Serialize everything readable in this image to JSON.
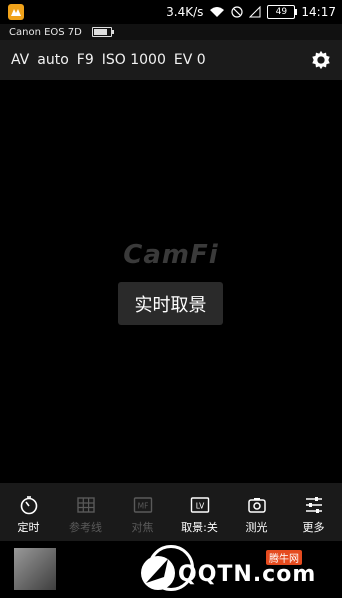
{
  "status": {
    "speed": "3.4K/s",
    "battery": "49",
    "time": "14:17"
  },
  "camera": {
    "name": "Canon EOS 7D",
    "battery_level": 0.85
  },
  "params": [
    "AV",
    "auto",
    "F9",
    "ISO 1000",
    "EV 0"
  ],
  "logo": "CamFi",
  "live_view_label": "实时取景",
  "toolbar": [
    {
      "label": "定时",
      "icon": "timer-icon",
      "enabled": true
    },
    {
      "label": "参考线",
      "icon": "grid-icon",
      "enabled": false
    },
    {
      "label": "对焦",
      "icon": "mf-icon",
      "icon_text": "MF",
      "enabled": false
    },
    {
      "label": "取景:关",
      "icon": "lv-icon",
      "icon_text": "LV",
      "enabled": true
    },
    {
      "label": "测光",
      "icon": "metering-icon",
      "enabled": true
    },
    {
      "label": "更多",
      "icon": "sliders-icon",
      "enabled": true
    }
  ],
  "watermark": {
    "main": "QQTN.com",
    "badge": "腾牛网"
  }
}
